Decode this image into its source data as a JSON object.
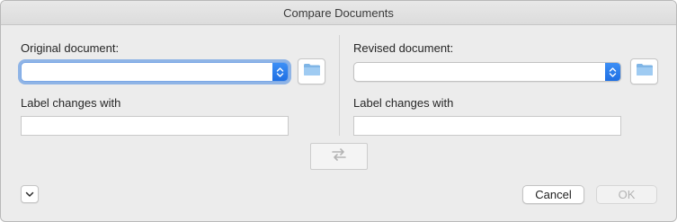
{
  "window": {
    "title": "Compare Documents"
  },
  "original": {
    "label": "Original document:",
    "select_value": "",
    "label_changes_caption": "Label changes with",
    "label_changes_value": ""
  },
  "revised": {
    "label": "Revised document:",
    "select_value": "",
    "label_changes_caption": "Label changes with",
    "label_changes_value": ""
  },
  "buttons": {
    "cancel": "Cancel",
    "ok": "OK"
  },
  "icons": {
    "browse_original": "folder-icon",
    "browse_revised": "folder-icon",
    "swap": "swap-arrows-icon",
    "disclosure": "chevron-down-icon",
    "stepper": "up-down-chevron-icon"
  },
  "colors": {
    "accent": "#2a7cf0",
    "folder": "#8fc0ea",
    "focus_ring": "#4487e2"
  }
}
